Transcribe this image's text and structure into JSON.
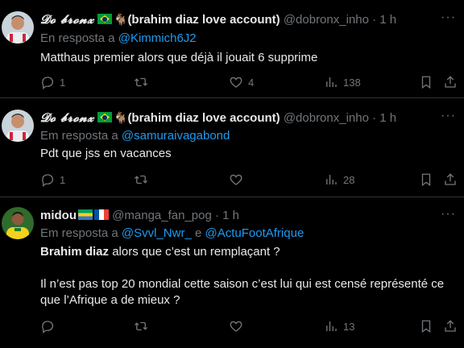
{
  "tweets": [
    {
      "name": "𝓓𝓸 𝓫𝓻𝓸𝓷𝔁",
      "name_suffix": "(brahim diaz love account)",
      "handle": "@dobronx_inho",
      "sep": "·",
      "time": "1 h",
      "reply_prefix": "En resposta a",
      "mentions": [
        "@Kimmich6J2"
      ],
      "text_bold": "",
      "text": "Matthaus premier alors que déjà il jouait 6 supprime",
      "text2": "",
      "stats": {
        "replies": "1",
        "retweets": "",
        "likes": "4",
        "views": "138"
      }
    },
    {
      "name": "𝓓𝓸 𝓫𝓻𝓸𝓷𝔁",
      "name_suffix": "(brahim diaz love account)",
      "handle": "@dobronx_inho",
      "sep": "·",
      "time": "1 h",
      "reply_prefix": "Em resposta a",
      "mentions": [
        "@samuraivagabond"
      ],
      "text_bold": "",
      "text": "Pdt que jss en vacances",
      "text2": "",
      "stats": {
        "replies": "1",
        "retweets": "",
        "likes": "",
        "views": "28"
      }
    },
    {
      "name": "midou",
      "name_suffix": "",
      "handle": "@manga_fan_pog",
      "sep": "·",
      "time": "1 h",
      "reply_prefix": "Em resposta a",
      "mentions": [
        "@Svvl_Nwr_",
        "@ActuFootAfrique"
      ],
      "mention_joiner": "e",
      "text_bold": "Brahim diaz",
      "text": " alors que c’est un remplaçant ?",
      "text2": "Il n’est pas top 20 mondial cette saison c’est lui qui est censé représenté ce que l’Afrique a de mieux ?",
      "stats": {
        "replies": "",
        "retweets": "",
        "likes": "",
        "views": "13"
      }
    }
  ],
  "icons": {
    "more": "more-horizontal-icon",
    "reply": "reply-icon",
    "retweet": "retweet-icon",
    "like": "heart-icon",
    "views": "views-icon",
    "bookmark": "bookmark-icon"
  },
  "colors": {
    "background": "#000000",
    "text": "#e7e9ea",
    "muted": "#71767b",
    "link": "#1d9bf0",
    "divider": "#2f3336"
  }
}
